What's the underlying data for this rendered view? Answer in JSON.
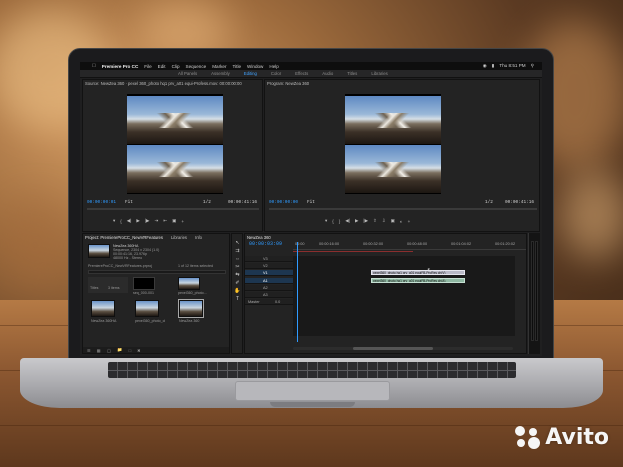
{
  "app": {
    "name": "Premiere Pro CC"
  },
  "menu": {
    "items": [
      "File",
      "Edit",
      "Clip",
      "Sequence",
      "Marker",
      "Title",
      "Window",
      "Help"
    ],
    "clock": "Thu 8:51 PM"
  },
  "workspaces": {
    "items": [
      "All Panels",
      "Assembly",
      "Editing",
      "Color",
      "Effects",
      "Audio",
      "Titles",
      "Libraries"
    ],
    "active": "Editing"
  },
  "source": {
    "title": "Source: NewZea 360 · pexel 360_photo hq1 prv_a01 equi-Profess.mov: 00:00:00:00",
    "timecode_in": "00:00:00:01",
    "timecode_out": "00:00:41:16",
    "zoom": "Fit",
    "resolution": "1/2"
  },
  "program": {
    "title": "Program: NewZea 360",
    "timecode_in": "00:00:00:00",
    "timecode_out": "00:00:41:16",
    "zoom": "Fit",
    "resolution": "1/2"
  },
  "project": {
    "tabs": [
      "Project: PremiereProCC_NewVRFeatures",
      "Libraries",
      "Info"
    ],
    "sequence_name": "NewZea 360HA",
    "sequence_info": "Sequence, 2304 x 2304 (1.0)",
    "sequence_fps": "00:00:41:16, 23.976p",
    "sequence_audio": "48000 Hz - Stereo",
    "search_label": "PremiereProCC_NewVRFeatures.prproj",
    "items_count": "1 of 12 items selected",
    "bins": [
      {
        "label": "Titles",
        "sub": "3 items"
      },
      {
        "label": "seq_000-001",
        "sub": ""
      },
      {
        "label": "pexel360_photo...",
        "sub": ""
      },
      {
        "label": "NewZea 360HA",
        "sub": ""
      },
      {
        "label": "pexel360_photo_cl",
        "sub": ""
      },
      {
        "label": "NewZea 360",
        "sub": ""
      }
    ]
  },
  "timeline": {
    "title": "NewZea 360",
    "playhead": "00:00:03:09",
    "ruler": [
      "00:00",
      "00:00:16:00",
      "00:00:32:00",
      "00:00:48:00",
      "00:01:04:02",
      "00:01:20:02"
    ],
    "tracks": [
      "V3",
      "V2",
      "V1",
      "A1",
      "A2",
      "A3",
      "Master"
    ],
    "clip_label": "pexel360_photo hq1 prv_a01 equiFB-ProRes ch(V)",
    "clip_label_audio": "pexel360_photo hq1 prv_a01 equiFB-ProRes ch(A)",
    "master_level": "0.0"
  },
  "tools": [
    "select-icon",
    "track-select-icon",
    "ripple-edit-icon",
    "razor-icon",
    "slip-icon",
    "pen-icon",
    "hand-icon",
    "type-icon"
  ],
  "watermark": {
    "brand": "Avito"
  }
}
